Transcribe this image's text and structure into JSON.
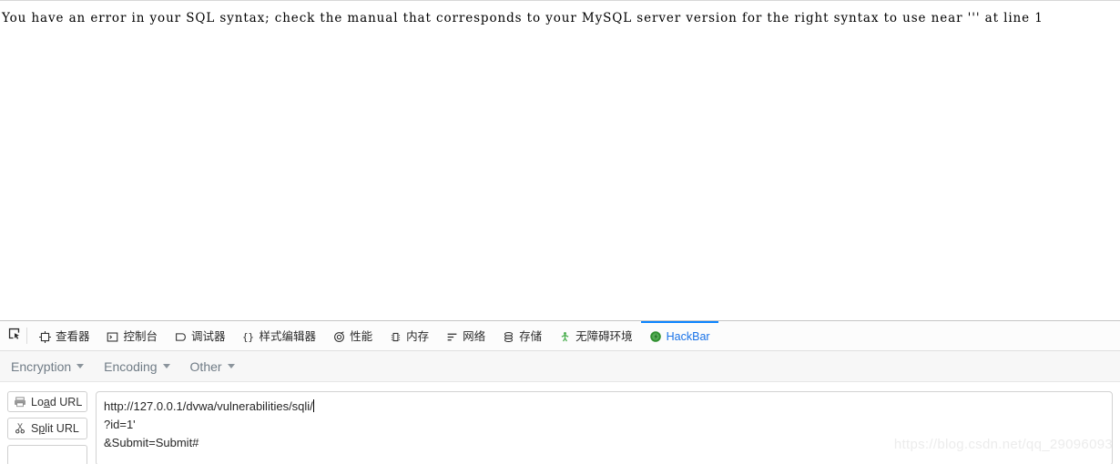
{
  "page": {
    "error_text": "You have an error in your SQL syntax; check the manual that corresponds to your MySQL server version for the right syntax to use near ''' at line 1"
  },
  "devtools": {
    "picker_icon": "element-picker-icon",
    "tabs": [
      {
        "label": "查看器",
        "icon": "inspector-icon",
        "active": false
      },
      {
        "label": "控制台",
        "icon": "console-icon",
        "active": false
      },
      {
        "label": "调试器",
        "icon": "debugger-icon",
        "active": false
      },
      {
        "label": "样式编辑器",
        "icon": "style-editor-icon",
        "active": false
      },
      {
        "label": "性能",
        "icon": "performance-icon",
        "active": false
      },
      {
        "label": "内存",
        "icon": "memory-icon",
        "active": false
      },
      {
        "label": "网络",
        "icon": "network-icon",
        "active": false
      },
      {
        "label": "存储",
        "icon": "storage-icon",
        "active": false
      },
      {
        "label": "无障碍环境",
        "icon": "accessibility-icon",
        "active": false
      },
      {
        "label": "HackBar",
        "icon": "hackbar-icon",
        "active": true
      }
    ],
    "active_tab_color": "#1a73e8",
    "active_tab_indicator_color": "#0a84ff"
  },
  "hackbar": {
    "menu": [
      {
        "label": "Encryption"
      },
      {
        "label": "Encoding"
      },
      {
        "label": "Other"
      }
    ],
    "buttons": [
      {
        "label_pre": "Lo",
        "label_key": "a",
        "label_post": "d URL",
        "icon": "load-url-icon"
      },
      {
        "label_pre": "S",
        "label_key": "p",
        "label_post": "lit URL",
        "icon": "split-url-icon"
      }
    ],
    "url_value": "http://127.0.0.1/dvwa/vulnerabilities/sqli/",
    "url_line2": "?id=1'",
    "url_line3": "&Submit=Submit#",
    "url_placeholder": "http://"
  },
  "watermark": {
    "text": "https://blog.csdn.net/qq_29096093"
  }
}
